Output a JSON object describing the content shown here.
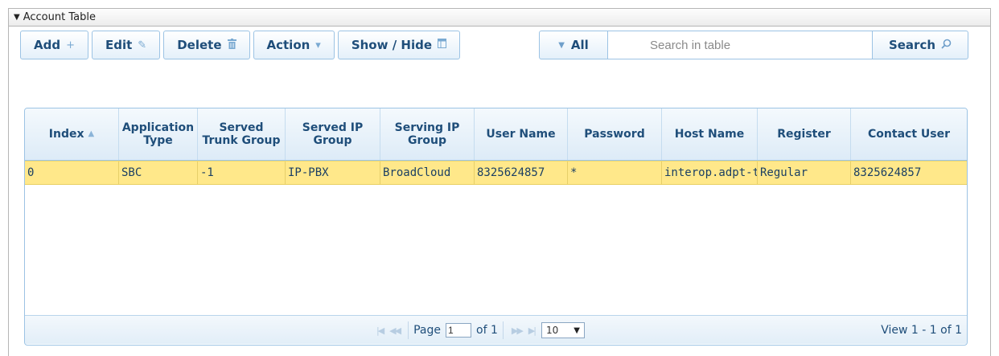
{
  "frame": {
    "title": "Account Table"
  },
  "toolbar": {
    "add_label": "Add",
    "add_icon": "+",
    "edit_label": "Edit",
    "edit_icon": "✎",
    "delete_label": "Delete",
    "delete_icon": "🗑",
    "action_label": "Action",
    "action_icon": "▾",
    "showhide_label": "Show / Hide",
    "showhide_icon": "⧉"
  },
  "search": {
    "filter_label": "All",
    "placeholder": "Search in table",
    "value": "",
    "button_label": "Search"
  },
  "table": {
    "columns": [
      "Index",
      "Application Type",
      "Served Trunk Group",
      "Served IP Group",
      "Serving IP Group",
      "User Name",
      "Password",
      "Host Name",
      "Register",
      "Contact User"
    ],
    "sorted_column": "Index",
    "sort_direction": "ascending",
    "rows": [
      [
        "0",
        "SBC",
        "-1",
        "IP-PBX",
        "BroadCloud",
        "8325624857",
        "*",
        "interop.adpt-tech.com",
        "Regular",
        "8325624857"
      ]
    ],
    "selected_row_color": "#ffe88a"
  },
  "pager": {
    "page_label": "Page",
    "page_value": "1",
    "of_label": "of 1",
    "page_size": "10",
    "view_info": "View 1 - 1 of 1"
  },
  "colors": {
    "accent": "#1f4e7a",
    "button_border": "#9cc3e4",
    "selected_row": "#ffe88a"
  }
}
